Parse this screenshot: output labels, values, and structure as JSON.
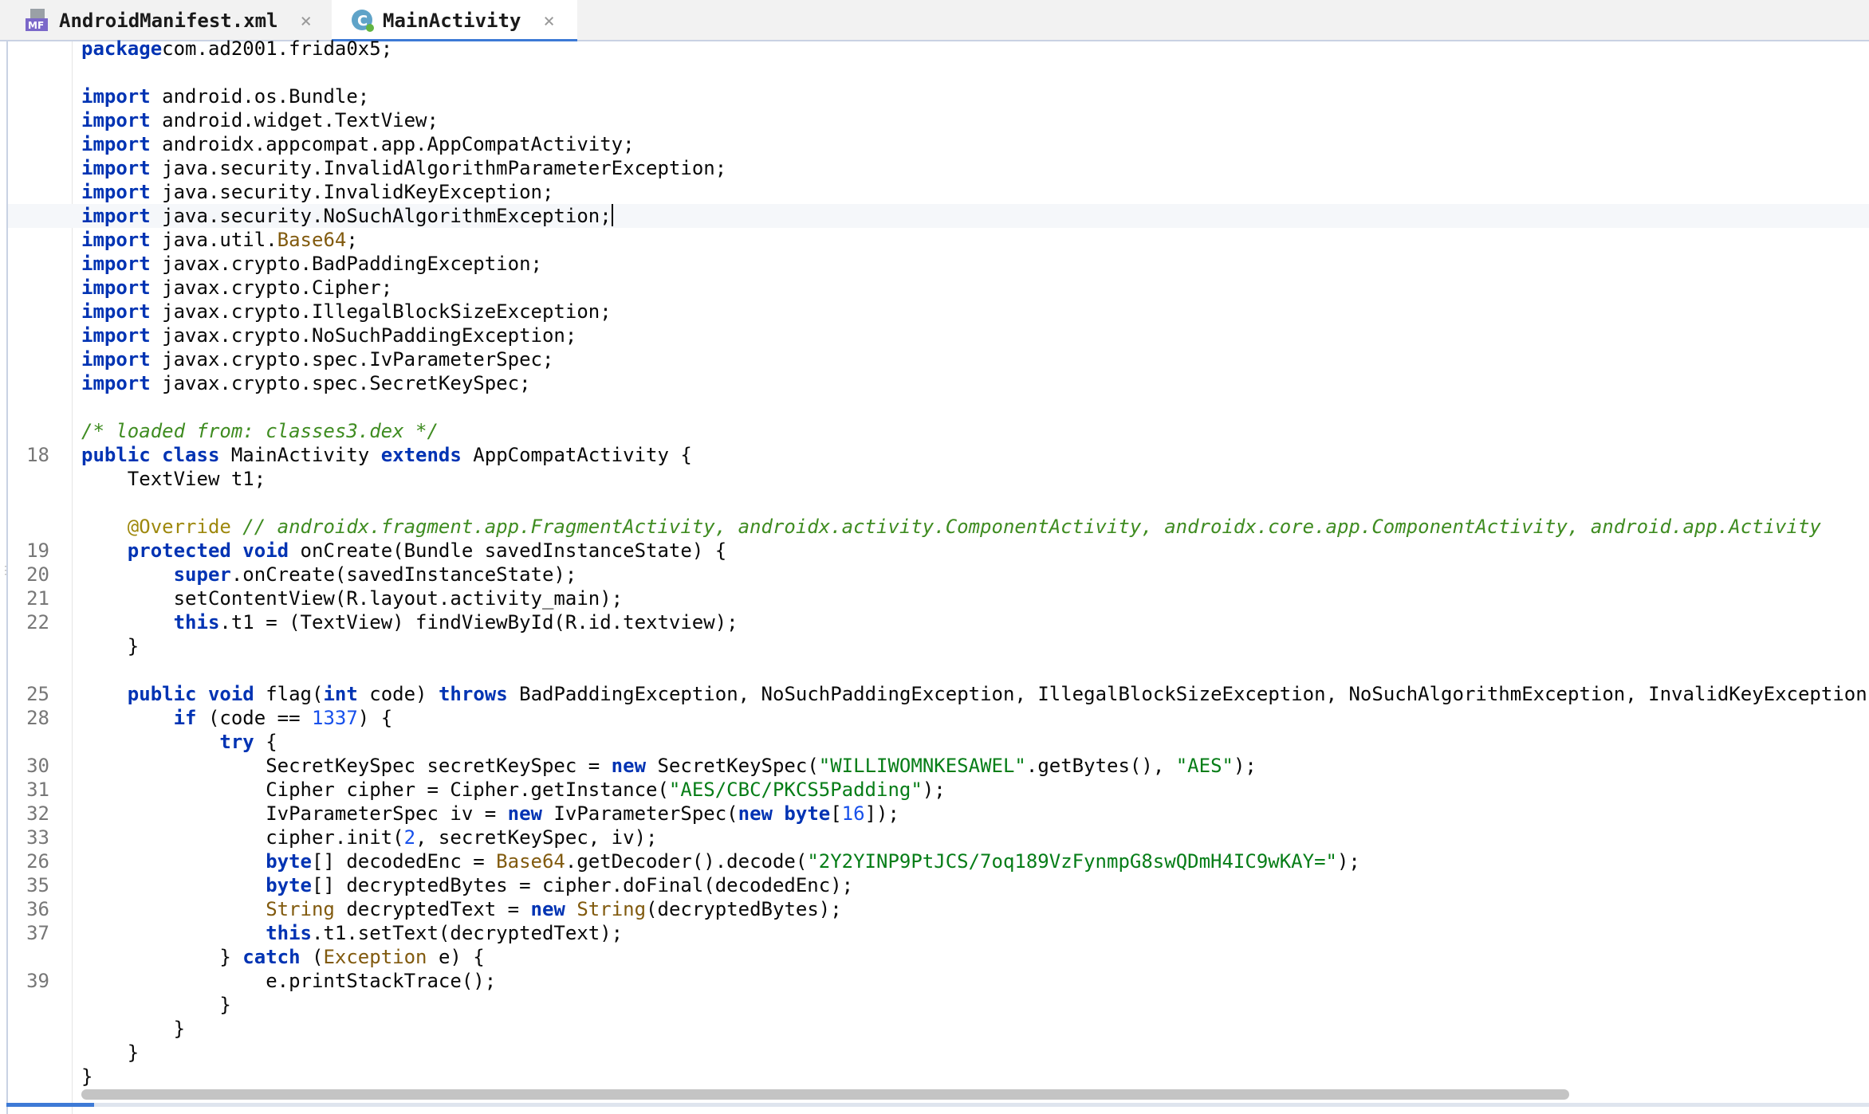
{
  "tabs": [
    {
      "label": "AndroidManifest.xml",
      "icon": "manifest-file-icon",
      "icon_text": "MF"
    },
    {
      "label": "MainActivity",
      "icon": "java-class-icon",
      "icon_text": "C"
    }
  ],
  "tab_close_glyph": "×",
  "colors": {
    "keyword": "#0033b3",
    "string": "#067d17",
    "number": "#1750eb",
    "comment": "#3f8c21",
    "annotation": "#9e880d",
    "tab_accent": "#3d7ad6"
  },
  "code_lines": [
    {
      "num": "",
      "tokens": [
        [
          "kw",
          "package"
        ],
        [
          "",
          "com.ad2001.frida0x5;"
        ]
      ]
    },
    {
      "num": "",
      "tokens": []
    },
    {
      "num": "",
      "tokens": [
        [
          "kw",
          "import"
        ],
        [
          "",
          " android.os.Bundle;"
        ]
      ]
    },
    {
      "num": "",
      "tokens": [
        [
          "kw",
          "import"
        ],
        [
          "",
          " android.widget.TextView;"
        ]
      ]
    },
    {
      "num": "",
      "tokens": [
        [
          "kw",
          "import"
        ],
        [
          "",
          " androidx.appcompat.app.AppCompatActivity;"
        ]
      ]
    },
    {
      "num": "",
      "tokens": [
        [
          "kw",
          "import"
        ],
        [
          "",
          " java.security.InvalidAlgorithmParameterException;"
        ]
      ]
    },
    {
      "num": "",
      "tokens": [
        [
          "kw",
          "import"
        ],
        [
          "",
          " java.security.InvalidKeyException;"
        ]
      ]
    },
    {
      "num": "",
      "current": true,
      "tokens": [
        [
          "kw",
          "import"
        ],
        [
          "",
          " java.security.NoSuchAlgorithmException;"
        ]
      ]
    },
    {
      "num": "",
      "tokens": [
        [
          "kw",
          "import"
        ],
        [
          "",
          " java.util."
        ],
        [
          "ty",
          "Base64"
        ],
        [
          "",
          ";"
        ]
      ]
    },
    {
      "num": "",
      "tokens": [
        [
          "kw",
          "import"
        ],
        [
          "",
          " javax.crypto.BadPaddingException;"
        ]
      ]
    },
    {
      "num": "",
      "tokens": [
        [
          "kw",
          "import"
        ],
        [
          "",
          " javax.crypto.Cipher;"
        ]
      ]
    },
    {
      "num": "",
      "tokens": [
        [
          "kw",
          "import"
        ],
        [
          "",
          " javax.crypto.IllegalBlockSizeException;"
        ]
      ]
    },
    {
      "num": "",
      "tokens": [
        [
          "kw",
          "import"
        ],
        [
          "",
          " javax.crypto.NoSuchPaddingException;"
        ]
      ]
    },
    {
      "num": "",
      "tokens": [
        [
          "kw",
          "import"
        ],
        [
          "",
          " javax.crypto.spec.IvParameterSpec;"
        ]
      ]
    },
    {
      "num": "",
      "tokens": [
        [
          "kw",
          "import"
        ],
        [
          "",
          " javax.crypto.spec.SecretKeySpec;"
        ]
      ]
    },
    {
      "num": "",
      "tokens": []
    },
    {
      "num": "",
      "tokens": [
        [
          "cm",
          "/* loaded from: classes3.dex */"
        ]
      ]
    },
    {
      "num": "18",
      "tokens": [
        [
          "kw",
          "public class"
        ],
        [
          "",
          " MainActivity "
        ],
        [
          "kw",
          "extends"
        ],
        [
          "",
          " AppCompatActivity {"
        ]
      ]
    },
    {
      "num": "",
      "tokens": [
        [
          "",
          "    TextView t1;"
        ]
      ]
    },
    {
      "num": "",
      "tokens": []
    },
    {
      "num": "",
      "tokens": [
        [
          "",
          "    "
        ],
        [
          "ann",
          "@Override"
        ],
        [
          "cm",
          " // androidx.fragment.app.FragmentActivity, androidx.activity.ComponentActivity, androidx.core.app.ComponentActivity, android.app.Activity"
        ]
      ]
    },
    {
      "num": "19",
      "tokens": [
        [
          "",
          "    "
        ],
        [
          "kw",
          "protected void"
        ],
        [
          "",
          " onCreate(Bundle savedInstanceState) {"
        ]
      ]
    },
    {
      "num": "20",
      "tokens": [
        [
          "",
          "        "
        ],
        [
          "kw",
          "super"
        ],
        [
          "",
          ".onCreate(savedInstanceState);"
        ]
      ]
    },
    {
      "num": "21",
      "tokens": [
        [
          "",
          "        setContentView(R.layout.activity_main);"
        ]
      ]
    },
    {
      "num": "22",
      "tokens": [
        [
          "",
          "        "
        ],
        [
          "kw",
          "this"
        ],
        [
          "",
          ".t1 = (TextView) findViewById(R.id.textview);"
        ]
      ]
    },
    {
      "num": "",
      "tokens": [
        [
          "",
          "    }"
        ]
      ]
    },
    {
      "num": "",
      "tokens": []
    },
    {
      "num": "25",
      "tokens": [
        [
          "",
          "    "
        ],
        [
          "kw",
          "public void"
        ],
        [
          "",
          " flag("
        ],
        [
          "kw",
          "int"
        ],
        [
          "",
          " code) "
        ],
        [
          "kw",
          "throws"
        ],
        [
          "",
          " BadPaddingException, NoSuchPaddingException, IllegalBlockSizeException, NoSuchAlgorithmException, InvalidKeyException, Inv"
        ]
      ]
    },
    {
      "num": "28",
      "tokens": [
        [
          "",
          "        "
        ],
        [
          "kw",
          "if"
        ],
        [
          "",
          " (code == "
        ],
        [
          "num",
          "1337"
        ],
        [
          "",
          ") {"
        ]
      ]
    },
    {
      "num": "",
      "tokens": [
        [
          "",
          "            "
        ],
        [
          "kw",
          "try"
        ],
        [
          "",
          " {"
        ]
      ]
    },
    {
      "num": "30",
      "tokens": [
        [
          "",
          "                SecretKeySpec secretKeySpec = "
        ],
        [
          "kw",
          "new"
        ],
        [
          "",
          " SecretKeySpec("
        ],
        [
          "str",
          "\"WILLIWOMNKESAWEL\""
        ],
        [
          "",
          ".getBytes(), "
        ],
        [
          "str",
          "\"AES\""
        ],
        [
          "",
          ");"
        ]
      ]
    },
    {
      "num": "31",
      "tokens": [
        [
          "",
          "                Cipher cipher = Cipher.getInstance("
        ],
        [
          "str",
          "\"AES/CBC/PKCS5Padding\""
        ],
        [
          "",
          ");"
        ]
      ]
    },
    {
      "num": "32",
      "tokens": [
        [
          "",
          "                IvParameterSpec iv = "
        ],
        [
          "kw",
          "new"
        ],
        [
          "",
          " IvParameterSpec("
        ],
        [
          "kw",
          "new byte"
        ],
        [
          "",
          "["
        ],
        [
          "num",
          "16"
        ],
        [
          "",
          "]);"
        ]
      ]
    },
    {
      "num": "33",
      "tokens": [
        [
          "",
          "                cipher.init("
        ],
        [
          "num",
          "2"
        ],
        [
          "",
          ", secretKeySpec, iv);"
        ]
      ]
    },
    {
      "num": "26",
      "tokens": [
        [
          "",
          "                "
        ],
        [
          "kw",
          "byte"
        ],
        [
          "",
          "[] decodedEnc = "
        ],
        [
          "ty",
          "Base64"
        ],
        [
          "",
          ".getDecoder().decode("
        ],
        [
          "str",
          "\"2Y2YINP9PtJCS/7oq189VzFynmpG8swQDmH4IC9wKAY=\""
        ],
        [
          "",
          ");"
        ]
      ]
    },
    {
      "num": "35",
      "tokens": [
        [
          "",
          "                "
        ],
        [
          "kw",
          "byte"
        ],
        [
          "",
          "[] decryptedBytes = cipher.doFinal(decodedEnc);"
        ]
      ]
    },
    {
      "num": "36",
      "tokens": [
        [
          "",
          "                "
        ],
        [
          "ty",
          "String"
        ],
        [
          "",
          " decryptedText = "
        ],
        [
          "kw",
          "new"
        ],
        [
          "",
          " "
        ],
        [
          "ty",
          "String"
        ],
        [
          "",
          "(decryptedBytes);"
        ]
      ]
    },
    {
      "num": "37",
      "tokens": [
        [
          "",
          "                "
        ],
        [
          "kw",
          "this"
        ],
        [
          "",
          ".t1.setText(decryptedText);"
        ]
      ]
    },
    {
      "num": "",
      "tokens": [
        [
          "",
          "            } "
        ],
        [
          "kw",
          "catch"
        ],
        [
          "",
          " ("
        ],
        [
          "ty",
          "Exception"
        ],
        [
          "",
          " e) {"
        ]
      ]
    },
    {
      "num": "39",
      "tokens": [
        [
          "",
          "                e.printStackTrace();"
        ]
      ]
    },
    {
      "num": "",
      "tokens": [
        [
          "",
          "            }"
        ]
      ]
    },
    {
      "num": "",
      "tokens": [
        [
          "",
          "        }"
        ]
      ]
    },
    {
      "num": "",
      "tokens": [
        [
          "",
          "    }"
        ]
      ]
    },
    {
      "num": "",
      "tokens": [
        [
          "",
          "}"
        ]
      ]
    }
  ]
}
